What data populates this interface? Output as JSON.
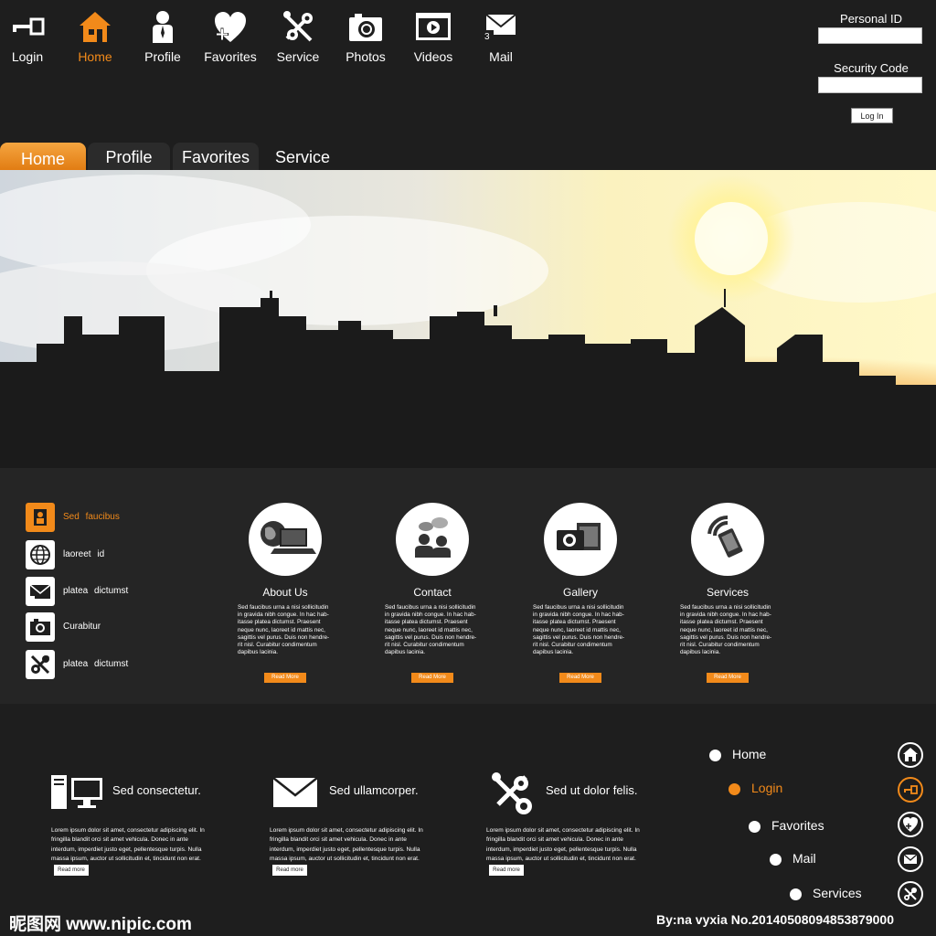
{
  "top_nav": [
    {
      "label": "Login",
      "icon": "key-icon"
    },
    {
      "label": "Home",
      "icon": "house-icon"
    },
    {
      "label": "Profile",
      "icon": "user-icon"
    },
    {
      "label": "Favorites",
      "icon": "heart-plus-icon"
    },
    {
      "label": "Service",
      "icon": "tools-icon"
    },
    {
      "label": "Photos",
      "icon": "camera-icon"
    },
    {
      "label": "Videos",
      "icon": "video-player-icon"
    },
    {
      "label": "Mail",
      "icon": "envelope-icon"
    }
  ],
  "login_panel": {
    "personal_id_label": "Personal ID",
    "security_code_label": "Security Code",
    "login_button": "Log In"
  },
  "tabs": [
    "Home",
    "Profile",
    "Favorites",
    "Service"
  ],
  "sidebar": [
    {
      "label": "Sed faucibus",
      "icon": "person-frame-icon"
    },
    {
      "label": "laoreet id",
      "icon": "globe-icon"
    },
    {
      "label": "platea dictumst",
      "icon": "envelope-icon"
    },
    {
      "label": "Curabitur",
      "icon": "camera-icon"
    },
    {
      "label": "platea dictumst",
      "icon": "tools-icon"
    }
  ],
  "features": [
    {
      "title": "About Us",
      "icon": "globe-laptop-icon",
      "lines": [
        "Sed faucibus urna a nisi sollicitudin",
        "in gravida nibh congue. In hac hab-",
        "itasse platea dictumst. Praesent",
        "neque nunc, laoreet id mattis nec,",
        "sagittis vel purus. Duis non hendre-",
        "rit nisl. Curabitur condimentum",
        "dapibus lacinia."
      ],
      "button": "Read More"
    },
    {
      "title": "Contact",
      "icon": "people-chat-icon",
      "lines": [
        "Sed faucibus urna a nisi sollicitudin",
        "in gravida nibh congue. In hac hab-",
        "itasse platea dictumst. Praesent",
        "neque nunc, laoreet id mattis nec,",
        "sagittis vel purus. Duis non hendre-",
        "rit nisl. Curabitur condimentum",
        "dapibus lacinia."
      ],
      "button": "Read More"
    },
    {
      "title": "Gallery",
      "icon": "camera-film-icon",
      "lines": [
        "Sed faucibus urna a nisi sollicitudin",
        "in gravida nibh congue. In hac hab-",
        "itasse platea dictumst. Praesent",
        "neque nunc, laoreet id mattis nec,",
        "sagittis vel purus. Duis non hendre-",
        "rit nisl. Curabitur condimentum",
        "dapibus lacinia."
      ],
      "button": "Read More"
    },
    {
      "title": "Services",
      "icon": "phone-signal-icon",
      "lines": [
        "Sed faucibus urna a nisi sollicitudin",
        "in gravida nibh congue. In hac hab-",
        "itasse platea dictumst. Praesent",
        "neque nunc, laoreet id mattis nec,",
        "sagittis vel purus. Duis non hendre-",
        "rit nisl. Curabitur condimentum",
        "dapibus lacinia."
      ],
      "button": "Read More"
    }
  ],
  "bottom_columns": [
    {
      "title": "Sed consectetur.",
      "icon": "computer-icon",
      "lines": [
        "Lorem ipsum dolor sit amet, consectetur adipiscing elit. In",
        "fringilla blandit orci sit amet vehicula. Donec in ante",
        "interdum, imperdiet justo eget, pellentesque turpis. Nulla",
        "massa ipsum, auctor ut sollicitudin et, tincidunt non erat."
      ],
      "button": "Read more"
    },
    {
      "title": "Sed ullamcorper.",
      "icon": "envelope-icon",
      "lines": [
        "Lorem ipsum dolor sit amet, consectetur adipiscing elit. In",
        "fringilla blandit orci sit amet vehicula. Donec in ante",
        "interdum, imperdiet justo eget, pellentesque turpis. Nulla",
        "massa ipsum, auctor ut sollicitudin et, tincidunt non erat."
      ],
      "button": "Read more"
    },
    {
      "title": "Sed ut dolor felis.",
      "icon": "tools-icon",
      "lines": [
        "Lorem ipsum dolor sit amet, consectetur adipiscing elit. In",
        "fringilla blandit orci sit amet vehicula. Donec in ante",
        "interdum, imperdiet justo eget, pellentesque turpis. Nulla",
        "massa ipsum, auctor ut sollicitudin et, tincidunt non erat."
      ],
      "button": "Read more"
    }
  ],
  "bottom_nav": [
    {
      "label": "Home",
      "icon": "house-icon"
    },
    {
      "label": "Login",
      "icon": "key-icon"
    },
    {
      "label": "Favorites",
      "icon": "heart-plus-icon"
    },
    {
      "label": "Mail",
      "icon": "envelope-icon"
    },
    {
      "label": "Services",
      "icon": "tools-icon"
    }
  ],
  "footer": {
    "watermark": "昵图网 www.nipic.com",
    "credit": "By:na vyxia  No.20140508094853879000"
  },
  "colors": {
    "accent": "#f28a1a",
    "background": "#1e1e1e",
    "panel": "#252525"
  }
}
